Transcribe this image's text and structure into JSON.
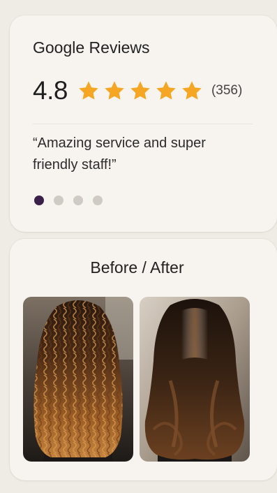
{
  "reviews": {
    "title": "Google Reviews",
    "rating": "4.8",
    "stars_filled": 5,
    "count": "(356)",
    "quote": "“Amazing service and super friendly staff!”",
    "pagination": {
      "total": 4,
      "active": 1
    },
    "star_color": "#f5a623"
  },
  "before_after": {
    "title": "Before / After",
    "images": [
      {
        "name": "before-hair-photo"
      },
      {
        "name": "after-hair-photo"
      }
    ]
  },
  "colors": {
    "background": "#efebe5",
    "card": "#f7f4ef",
    "active_dot": "#3a1f4a",
    "inactive_dot": "#cfcac4"
  }
}
